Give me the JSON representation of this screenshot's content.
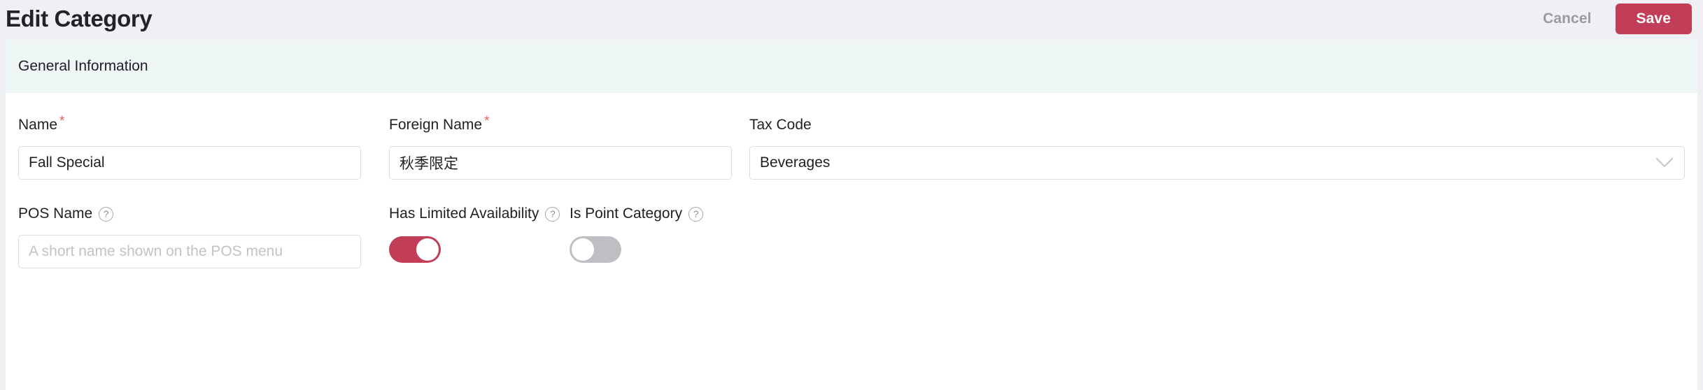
{
  "header": {
    "title": "Edit Category",
    "cancel_label": "Cancel",
    "save_label": "Save"
  },
  "section": {
    "title": "General Information"
  },
  "fields": {
    "name": {
      "label": "Name",
      "required_marker": "*",
      "value": "Fall Special",
      "placeholder": ""
    },
    "foreign_name": {
      "label": "Foreign Name",
      "required_marker": "*",
      "value": "秋季限定",
      "placeholder": ""
    },
    "tax_code": {
      "label": "Tax Code",
      "value": "Beverages",
      "chevron": "chevron-down-icon"
    },
    "pos_name": {
      "label": "POS Name",
      "help": "?",
      "value": "",
      "placeholder": "A short name shown on the POS menu"
    },
    "has_limited_availability": {
      "label": "Has Limited Availability",
      "help": "?",
      "state": "on"
    },
    "is_point_category": {
      "label": "Is Point Category",
      "help": "?",
      "state": "off"
    }
  },
  "colors": {
    "accent": "#c23d57",
    "required": "#e8606b",
    "header_bg": "#f0f0f4",
    "section_bg": "#eef7f6",
    "toggle_off": "#bfbfc3"
  }
}
